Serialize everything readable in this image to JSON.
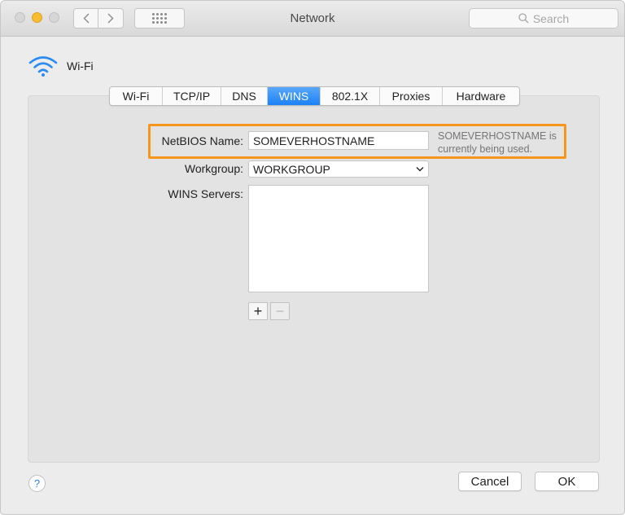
{
  "window": {
    "title": "Network",
    "search_placeholder": "Search"
  },
  "service": {
    "name": "Wi-Fi"
  },
  "tabs": [
    {
      "label": "Wi-Fi"
    },
    {
      "label": "TCP/IP"
    },
    {
      "label": "DNS"
    },
    {
      "label": "WINS",
      "active": true
    },
    {
      "label": "802.1X"
    },
    {
      "label": "Proxies"
    },
    {
      "label": "Hardware"
    }
  ],
  "wins": {
    "netbios_label": "NetBIOS Name:",
    "netbios_value": "SOMEVERHOSTNAME",
    "netbios_hint": "SOMEVERHOSTNAME is currently being used.",
    "workgroup_label": "Workgroup:",
    "workgroup_value": "WORKGROUP",
    "servers_label": "WINS Servers:",
    "add_symbol": "+",
    "remove_symbol": "−"
  },
  "footer": {
    "help_symbol": "?",
    "cancel_label": "Cancel",
    "ok_label": "OK"
  },
  "colors": {
    "highlight": "#f7961d",
    "active_tab": "#1a82f6",
    "wifi_icon": "#2a8cf2",
    "minimize": "#f5bd2f"
  }
}
